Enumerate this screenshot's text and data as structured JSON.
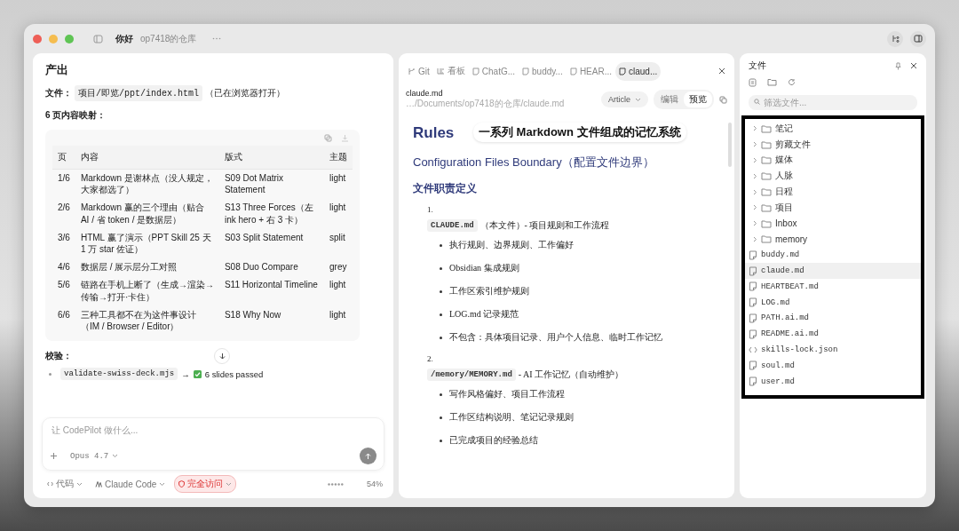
{
  "window": {
    "title": "你好",
    "subtitle": "op7418的仓库"
  },
  "chat": {
    "heading": "产出",
    "file_label": "文件：",
    "file_path": "项目/即览/ppt/index.html",
    "file_note": "（已在浏览器打开）",
    "mapping_label": "6 页内容映射：",
    "table": {
      "columns": [
        "页",
        "内容",
        "版式",
        "主题"
      ],
      "rows": [
        [
          "1/6",
          "Markdown 是谢林点（没人规定，大家都选了）",
          "S09 Dot Matrix Statement",
          "light"
        ],
        [
          "2/6",
          "Markdown 赢的三个理由（贴合 AI / 省 token / 是数据层）",
          "S13 Three Forces（左 ink hero + 右 3 卡）",
          "light"
        ],
        [
          "3/6",
          "HTML 赢了演示（PPT Skill 25 天 1 万 star 佐证）",
          "S03 Split Statement",
          "split"
        ],
        [
          "4/6",
          "数据层 / 展示层分工对照",
          "S08 Duo Compare",
          "grey"
        ],
        [
          "5/6",
          "链路在手机上断了（生成→渲染→传输→打开·卡住）",
          "S11 Horizontal Timeline",
          "light"
        ],
        [
          "6/6",
          "三种工具都不在为这件事设计（IM / Browser / Editor）",
          "S18 Why Now",
          "light"
        ]
      ]
    },
    "check_label": "校验：",
    "check_code": "validate-swiss-deck.mjs",
    "check_arrow": "→",
    "check_result": "6 slides passed",
    "composer": {
      "placeholder": "让 CodePilot 做什么...",
      "model": "Opus 4.7"
    },
    "footer": [
      {
        "label": "代码",
        "kind": "code"
      },
      {
        "label": "Claude Code",
        "kind": "agent"
      },
      {
        "label": "完全访问",
        "kind": "danger"
      }
    ],
    "context": "54%"
  },
  "editor": {
    "tabs": [
      {
        "label": "Git",
        "kind": "git",
        "selected": false
      },
      {
        "label": "看板",
        "kind": "board",
        "selected": false
      },
      {
        "label": "ChatG...",
        "kind": "file",
        "selected": false
      },
      {
        "label": "buddy...",
        "kind": "file",
        "selected": false
      },
      {
        "label": "HEAR...",
        "kind": "file",
        "selected": false
      },
      {
        "label": "claud...",
        "kind": "file",
        "selected": true
      }
    ],
    "file_name": "claude.md",
    "file_path": "…/Documents/op7418的仓库/claude.md",
    "view": "Article",
    "modes": [
      {
        "label": "编辑",
        "selected": false
      },
      {
        "label": "预览",
        "selected": true
      }
    ],
    "doc": {
      "h1": "Rules",
      "h2": "Configuration Files Boundary（配置文件边界）",
      "h3": "文件职责定义",
      "items": [
        {
          "number": "1.",
          "code": "CLAUDE.md",
          "text": "（本文件）- 项目规则和工作流程",
          "bullets": [
            "执行规则、边界规则、工作偏好",
            "Obsidian 集成规则",
            "工作区索引维护规则",
            "LOG.md 记录规范",
            "不包含：具体项目记录、用户个人信息、临时工作记忆"
          ]
        },
        {
          "number": "2.",
          "code": "/memory/MEMORY.md",
          "text": "- AI 工作记忆（自动维护）",
          "bullets": [
            "写作风格偏好、项目工作流程",
            "工作区结构说明、笔记记录规则",
            "已完成项目的经验总结"
          ]
        }
      ]
    },
    "caption": "一系列 Markdown 文件组成的记忆系统"
  },
  "files": {
    "title": "文件",
    "filter_placeholder": "筛选文件...",
    "tree": [
      {
        "name": "笔记",
        "kind": "folder",
        "expanded": false,
        "selected": false
      },
      {
        "name": "剪藏文件",
        "kind": "folder",
        "expanded": false,
        "selected": false
      },
      {
        "name": "媒体",
        "kind": "folder",
        "expanded": false,
        "selected": false
      },
      {
        "name": "人脉",
        "kind": "folder",
        "expanded": false,
        "selected": false
      },
      {
        "name": "日程",
        "kind": "folder",
        "expanded": false,
        "selected": false
      },
      {
        "name": "项目",
        "kind": "folder",
        "expanded": false,
        "selected": false
      },
      {
        "name": "Inbox",
        "kind": "folder",
        "expanded": false,
        "selected": false
      },
      {
        "name": "memory",
        "kind": "folder",
        "expanded": false,
        "selected": false
      },
      {
        "name": "buddy.md",
        "kind": "file",
        "selected": false
      },
      {
        "name": "claude.md",
        "kind": "file",
        "selected": true
      },
      {
        "name": "HEARTBEAT.md",
        "kind": "file",
        "selected": false
      },
      {
        "name": "LOG.md",
        "kind": "file",
        "selected": false
      },
      {
        "name": "PATH.ai.md",
        "kind": "file",
        "selected": false
      },
      {
        "name": "README.ai.md",
        "kind": "file",
        "selected": false
      },
      {
        "name": "skills-lock.json",
        "kind": "code",
        "selected": false
      },
      {
        "name": "soul.md",
        "kind": "file",
        "selected": false
      },
      {
        "name": "user.md",
        "kind": "file",
        "selected": false
      }
    ]
  }
}
